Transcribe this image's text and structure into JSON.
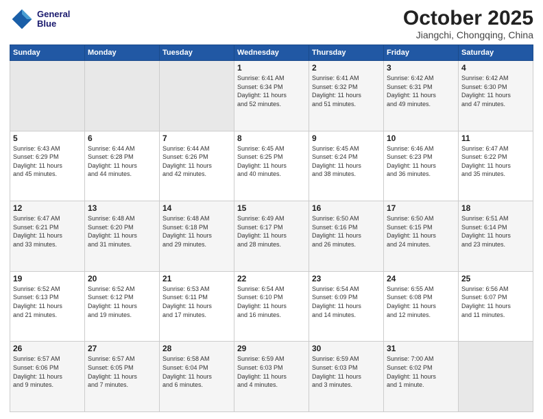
{
  "header": {
    "logo_line1": "General",
    "logo_line2": "Blue",
    "month_title": "October 2025",
    "subtitle": "Jiangchi, Chongqing, China"
  },
  "weekdays": [
    "Sunday",
    "Monday",
    "Tuesday",
    "Wednesday",
    "Thursday",
    "Friday",
    "Saturday"
  ],
  "weeks": [
    [
      {
        "day": "",
        "info": ""
      },
      {
        "day": "",
        "info": ""
      },
      {
        "day": "",
        "info": ""
      },
      {
        "day": "1",
        "info": "Sunrise: 6:41 AM\nSunset: 6:34 PM\nDaylight: 11 hours\nand 52 minutes."
      },
      {
        "day": "2",
        "info": "Sunrise: 6:41 AM\nSunset: 6:32 PM\nDaylight: 11 hours\nand 51 minutes."
      },
      {
        "day": "3",
        "info": "Sunrise: 6:42 AM\nSunset: 6:31 PM\nDaylight: 11 hours\nand 49 minutes."
      },
      {
        "day": "4",
        "info": "Sunrise: 6:42 AM\nSunset: 6:30 PM\nDaylight: 11 hours\nand 47 minutes."
      }
    ],
    [
      {
        "day": "5",
        "info": "Sunrise: 6:43 AM\nSunset: 6:29 PM\nDaylight: 11 hours\nand 45 minutes."
      },
      {
        "day": "6",
        "info": "Sunrise: 6:44 AM\nSunset: 6:28 PM\nDaylight: 11 hours\nand 44 minutes."
      },
      {
        "day": "7",
        "info": "Sunrise: 6:44 AM\nSunset: 6:26 PM\nDaylight: 11 hours\nand 42 minutes."
      },
      {
        "day": "8",
        "info": "Sunrise: 6:45 AM\nSunset: 6:25 PM\nDaylight: 11 hours\nand 40 minutes."
      },
      {
        "day": "9",
        "info": "Sunrise: 6:45 AM\nSunset: 6:24 PM\nDaylight: 11 hours\nand 38 minutes."
      },
      {
        "day": "10",
        "info": "Sunrise: 6:46 AM\nSunset: 6:23 PM\nDaylight: 11 hours\nand 36 minutes."
      },
      {
        "day": "11",
        "info": "Sunrise: 6:47 AM\nSunset: 6:22 PM\nDaylight: 11 hours\nand 35 minutes."
      }
    ],
    [
      {
        "day": "12",
        "info": "Sunrise: 6:47 AM\nSunset: 6:21 PM\nDaylight: 11 hours\nand 33 minutes."
      },
      {
        "day": "13",
        "info": "Sunrise: 6:48 AM\nSunset: 6:20 PM\nDaylight: 11 hours\nand 31 minutes."
      },
      {
        "day": "14",
        "info": "Sunrise: 6:48 AM\nSunset: 6:18 PM\nDaylight: 11 hours\nand 29 minutes."
      },
      {
        "day": "15",
        "info": "Sunrise: 6:49 AM\nSunset: 6:17 PM\nDaylight: 11 hours\nand 28 minutes."
      },
      {
        "day": "16",
        "info": "Sunrise: 6:50 AM\nSunset: 6:16 PM\nDaylight: 11 hours\nand 26 minutes."
      },
      {
        "day": "17",
        "info": "Sunrise: 6:50 AM\nSunset: 6:15 PM\nDaylight: 11 hours\nand 24 minutes."
      },
      {
        "day": "18",
        "info": "Sunrise: 6:51 AM\nSunset: 6:14 PM\nDaylight: 11 hours\nand 23 minutes."
      }
    ],
    [
      {
        "day": "19",
        "info": "Sunrise: 6:52 AM\nSunset: 6:13 PM\nDaylight: 11 hours\nand 21 minutes."
      },
      {
        "day": "20",
        "info": "Sunrise: 6:52 AM\nSunset: 6:12 PM\nDaylight: 11 hours\nand 19 minutes."
      },
      {
        "day": "21",
        "info": "Sunrise: 6:53 AM\nSunset: 6:11 PM\nDaylight: 11 hours\nand 17 minutes."
      },
      {
        "day": "22",
        "info": "Sunrise: 6:54 AM\nSunset: 6:10 PM\nDaylight: 11 hours\nand 16 minutes."
      },
      {
        "day": "23",
        "info": "Sunrise: 6:54 AM\nSunset: 6:09 PM\nDaylight: 11 hours\nand 14 minutes."
      },
      {
        "day": "24",
        "info": "Sunrise: 6:55 AM\nSunset: 6:08 PM\nDaylight: 11 hours\nand 12 minutes."
      },
      {
        "day": "25",
        "info": "Sunrise: 6:56 AM\nSunset: 6:07 PM\nDaylight: 11 hours\nand 11 minutes."
      }
    ],
    [
      {
        "day": "26",
        "info": "Sunrise: 6:57 AM\nSunset: 6:06 PM\nDaylight: 11 hours\nand 9 minutes."
      },
      {
        "day": "27",
        "info": "Sunrise: 6:57 AM\nSunset: 6:05 PM\nDaylight: 11 hours\nand 7 minutes."
      },
      {
        "day": "28",
        "info": "Sunrise: 6:58 AM\nSunset: 6:04 PM\nDaylight: 11 hours\nand 6 minutes."
      },
      {
        "day": "29",
        "info": "Sunrise: 6:59 AM\nSunset: 6:03 PM\nDaylight: 11 hours\nand 4 minutes."
      },
      {
        "day": "30",
        "info": "Sunrise: 6:59 AM\nSunset: 6:03 PM\nDaylight: 11 hours\nand 3 minutes."
      },
      {
        "day": "31",
        "info": "Sunrise: 7:00 AM\nSunset: 6:02 PM\nDaylight: 11 hours\nand 1 minute."
      },
      {
        "day": "",
        "info": ""
      }
    ]
  ]
}
